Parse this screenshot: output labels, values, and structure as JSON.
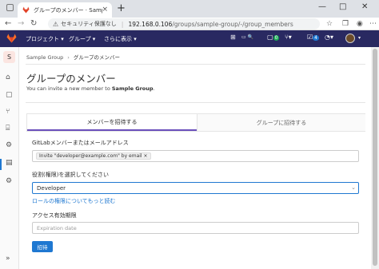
{
  "browser": {
    "tab_title": "グループのメンバー · Sample Group",
    "tab_close": "×",
    "new_tab": "+",
    "security_label": "セキュリティ保護なし",
    "url_host": "192.168.0.106",
    "url_path": "/groups/sample-group/-/group_members"
  },
  "gitlab_nav": {
    "projects": "プロジェクト ▾",
    "groups": "グループ ▾",
    "more": "さらに表示 ▾",
    "issues_badge": "0",
    "todo_badge": "4"
  },
  "sidebar": {
    "group_initial": "S"
  },
  "breadcrumb": {
    "group": "Sample Group",
    "current": "グループのメンバー"
  },
  "page": {
    "title": "グループのメンバー",
    "subtitle_prefix": "You can invite a new member to ",
    "subtitle_group": "Sample Group",
    "subtitle_suffix": "."
  },
  "tabs": {
    "invite_member": "メンバーを招待する",
    "invite_group": "グループに招待する"
  },
  "form": {
    "member_label": "GitLabメンバーまたはメールアドレス",
    "member_token": "Invite \"developer@example.com\" by email ×",
    "role_label": "役割(権限)を選択してください",
    "role_value": "Developer",
    "role_link": "ロールの権限についてもっと読む",
    "expiry_label": "アクセス有効期限",
    "expiry_placeholder": "Expiration date",
    "submit_label": "招待"
  }
}
